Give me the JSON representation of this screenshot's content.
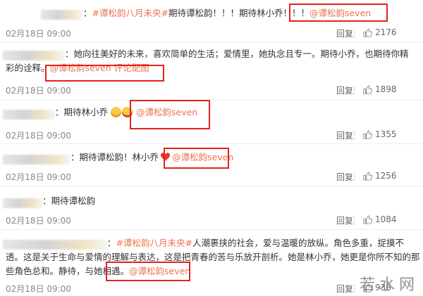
{
  "comments": [
    {
      "prefix": "：",
      "topic": "#谭松韵八月未央#",
      "text": "期待谭松韵！！！期待林小乔！！！",
      "mention": "@谭松韵seven",
      "date": "02月18日 09:00",
      "reply": "回复",
      "likes": "2176"
    },
    {
      "prefix": "：",
      "line1": "她向往美好的未来，喜欢简单的生活；爱情里，她执念且专一。期待小乔，也期待你精",
      "line2": "彩的诠释。",
      "mention": "@谭松韵seven",
      "link": "评论配图",
      "date": "02月18日 09:00",
      "reply": "回复",
      "likes": "1898"
    },
    {
      "prefix": "：",
      "text": "期待林小乔",
      "mention": "@谭松韵seven",
      "date": "02月18日 09:00",
      "reply": "回复",
      "likes": "1355"
    },
    {
      "prefix": "：",
      "text": "期待谭松韵！林小乔",
      "mention": "@谭松韵seven",
      "date": "02月18日 09:00",
      "reply": "回复",
      "likes": "1256"
    },
    {
      "prefix": "：",
      "text": "期待谭松韵",
      "date": "02月18日 09:00",
      "reply": "回复",
      "likes": "1084"
    },
    {
      "prefix": "：",
      "topic": "#谭松韵八月未央#",
      "line1": "人潮裹挟的社会，爱与温暖的放纵。角色多重，捉摸不",
      "line2": "透。这是关于生命与爱情的理解与表达，这是把青春的苦与乐放开剖析。她是林小乔，她更是你所不知的那",
      "line3": "些角色总和。静待，与她相遇。",
      "mention": "@谭松韵seven",
      "date": "02月18日 09:00",
      "reply": "回复",
      "likes": "938"
    }
  ],
  "watermark": "若水网",
  "colors": {
    "accent": "#eb7350",
    "highlight_box": "#e5211c"
  }
}
